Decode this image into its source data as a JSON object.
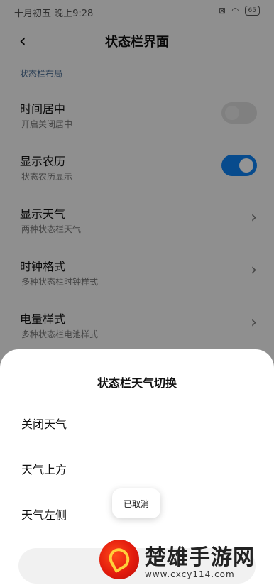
{
  "status_bar": {
    "time": "十月初五 晚上9:28",
    "signal_icon": "signal-icon",
    "wifi_icon": "wifi-icon",
    "battery_text": "65"
  },
  "header": {
    "back_icon": "back-arrow-icon",
    "title": "状态栏界面"
  },
  "settings": {
    "section_label": "状态栏布局",
    "items": [
      {
        "title": "时间居中",
        "subtitle": "开启关闭居中",
        "control": "toggle",
        "enabled": false
      },
      {
        "title": "显示农历",
        "subtitle": "状态农历显示",
        "control": "toggle",
        "enabled": true
      },
      {
        "title": "显示天气",
        "subtitle": "两种状态栏天气",
        "control": "chevron",
        "chevron": "›"
      },
      {
        "title": "时钟格式",
        "subtitle": "多种状态栏时钟样式",
        "control": "chevron",
        "chevron": "›"
      },
      {
        "title": "电量样式",
        "subtitle": "多种状态栏电池样式",
        "control": "chevron",
        "chevron": "›"
      }
    ]
  },
  "dialog": {
    "title": "状态栏天气切换",
    "options": [
      "关闭天气",
      "天气上方",
      "天气左侧"
    ]
  },
  "toast": {
    "text": "已取消"
  },
  "watermark": {
    "name": "楚雄手游网",
    "url": "www.cxcy114.com"
  },
  "colors": {
    "accent": "#0d82f3",
    "section_label": "#4c6f95",
    "overlay": "rgba(0,0,0,0.42)"
  }
}
